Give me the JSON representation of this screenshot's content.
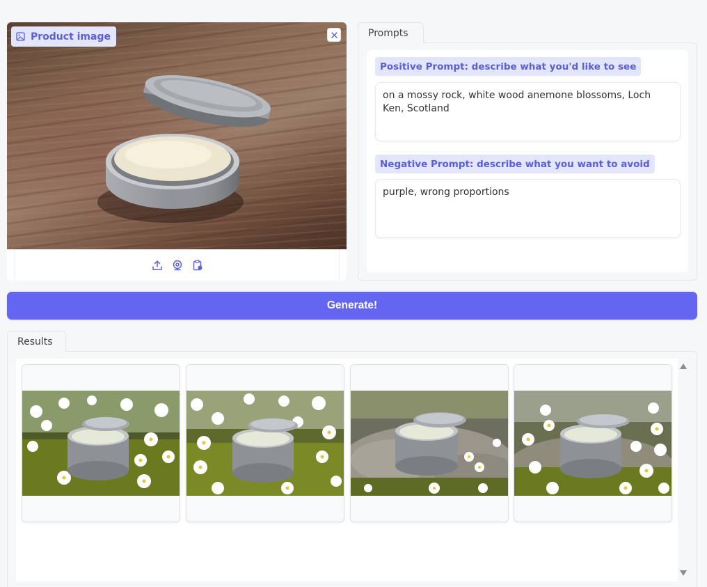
{
  "image_panel": {
    "label": "Product image",
    "label_icon": "image-icon",
    "close_icon": "close-icon",
    "toolbar_icons": [
      "upload-icon",
      "webcam-icon",
      "clipboard-icon"
    ]
  },
  "prompts": {
    "tab_label": "Prompts",
    "positive": {
      "label": "Positive Prompt: describe what you'd like to see",
      "value": "on a mossy rock, white wood anemone blossoms, Loch Ken, Scotland"
    },
    "negative": {
      "label": "Negative Prompt: describe what you want to avoid",
      "value": "purple, wrong proportions"
    }
  },
  "generate": {
    "label": "Generate!"
  },
  "results": {
    "tab_label": "Results",
    "scroll_up_icon": "triangle-up-icon",
    "scroll_down_icon": "triangle-down-icon"
  },
  "colors": {
    "accent": "#6466f1",
    "label_bg": "#e3e5fa",
    "label_text": "#5b5fd6",
    "page_bg": "#f6f7f9"
  }
}
